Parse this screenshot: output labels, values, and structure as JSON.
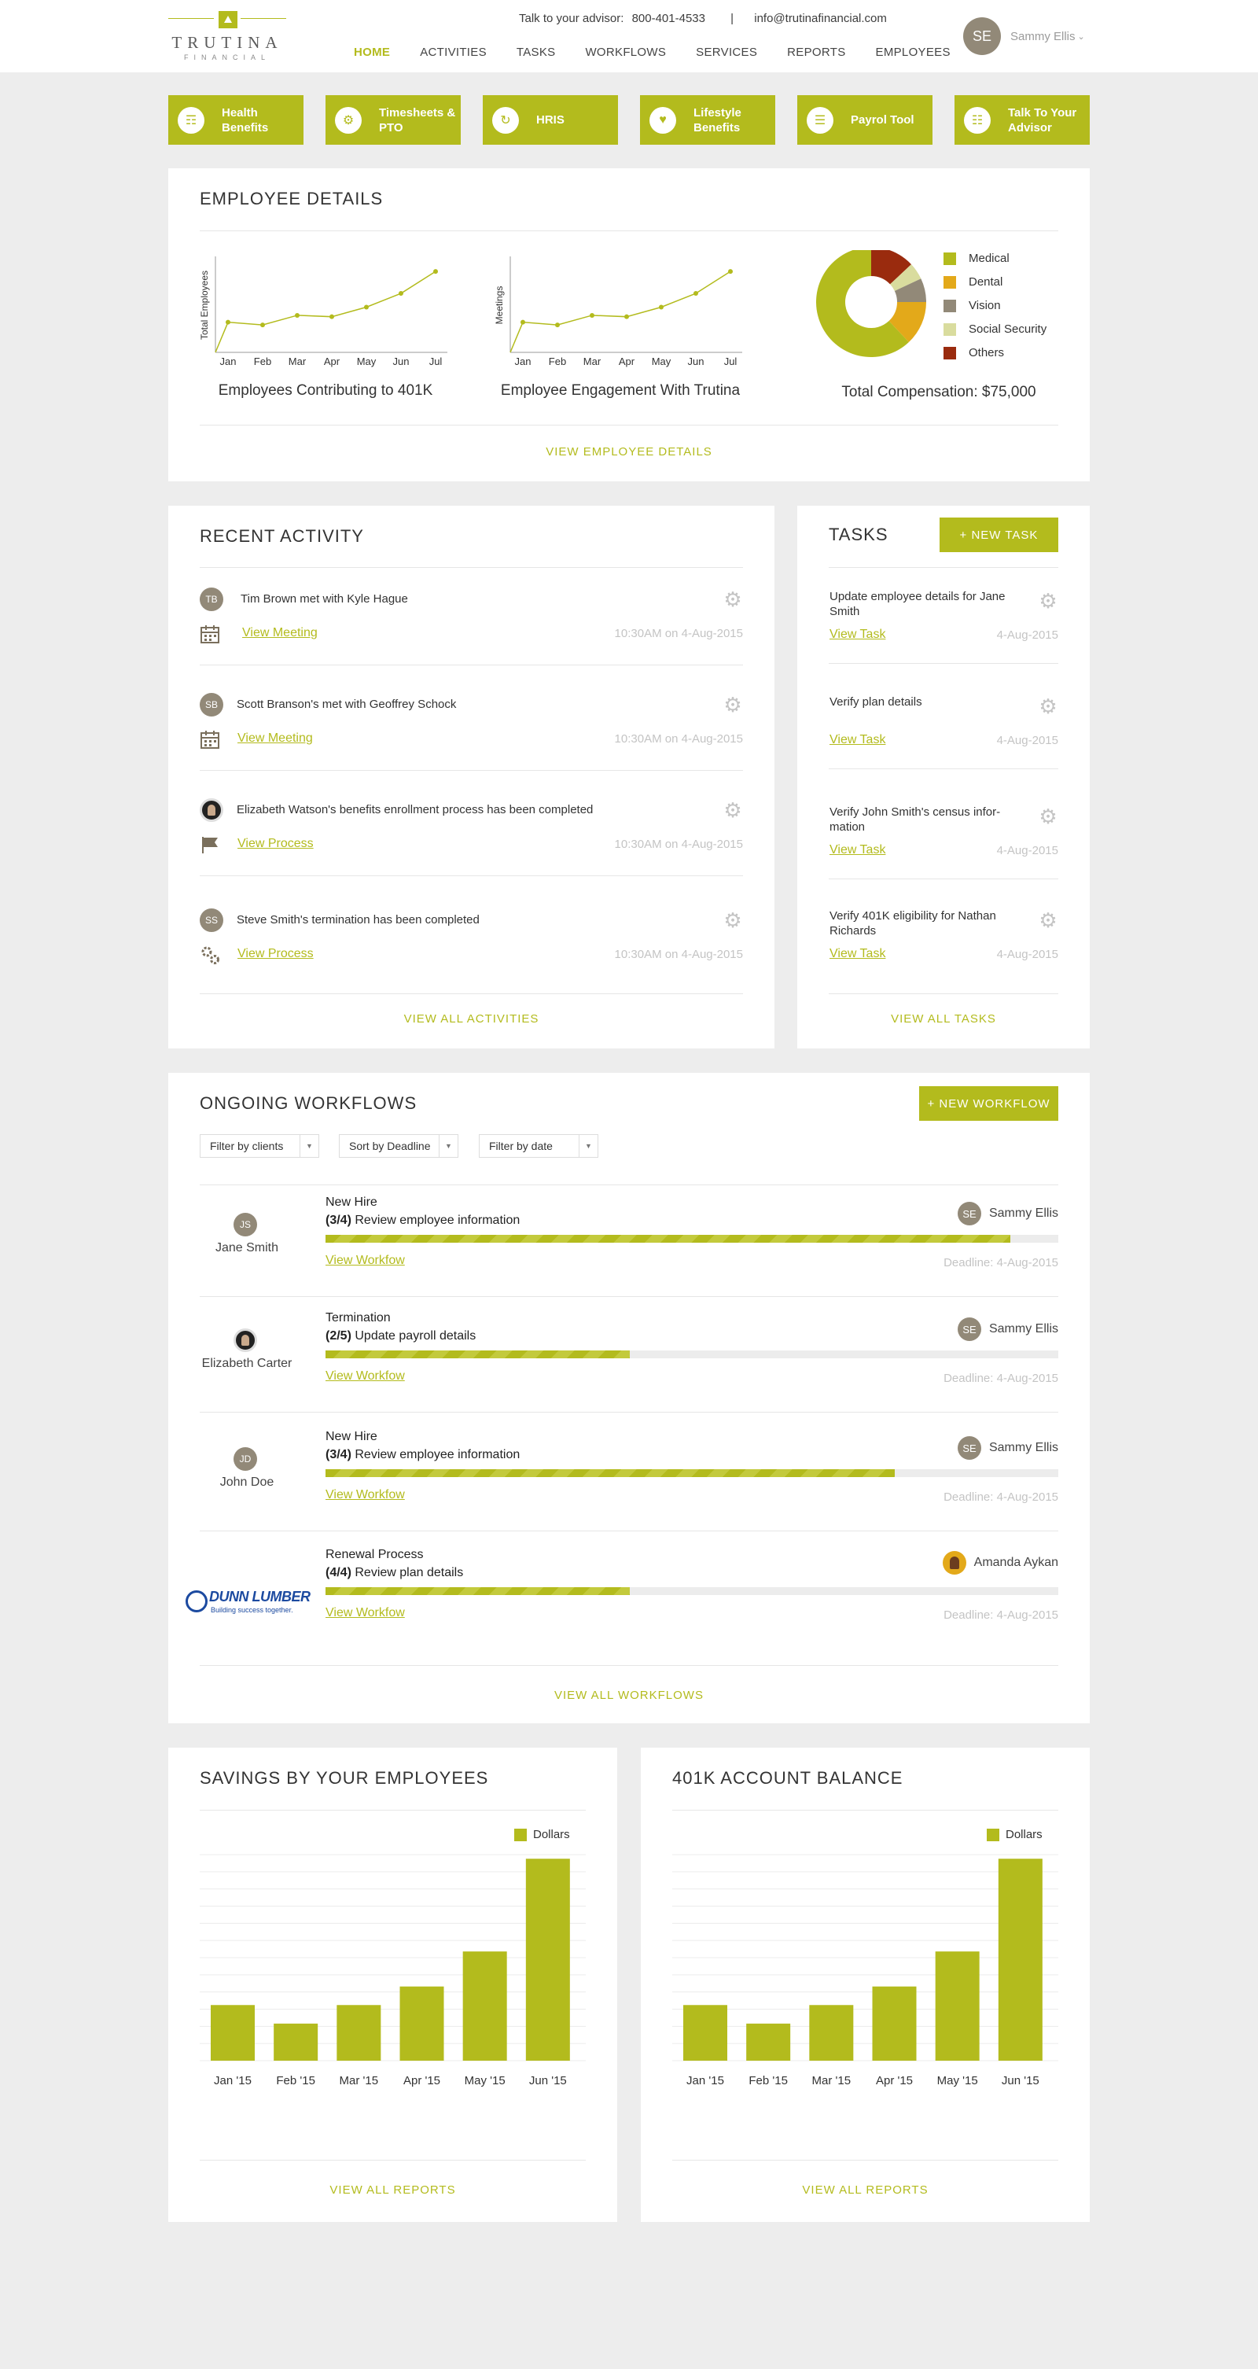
{
  "brand": {
    "name": "TRUTINA",
    "sub": "FINANCIAL",
    "accent": "#b3bb1d"
  },
  "contact": {
    "advisor_label": "Talk to your advisor:",
    "phone": "800-401-4533",
    "sep": "|",
    "email": "info@trutinafinancial.com"
  },
  "nav": {
    "items": [
      "HOME",
      "ACTIVITIES",
      "TASKS",
      "WORKFLOWS",
      "SERVICES",
      "REPORTS",
      "EMPLOYEES"
    ],
    "active": "HOME"
  },
  "user": {
    "initials": "SE",
    "name": "Sammy Ellis"
  },
  "quick_links": [
    {
      "label": "Health Benefits",
      "icon": "handshake-icon",
      "glyph": "☶"
    },
    {
      "label": "Timesheets & PTO",
      "icon": "gear-icon",
      "glyph": "⚙"
    },
    {
      "label": "HRIS",
      "icon": "refresh-icon",
      "glyph": "↻"
    },
    {
      "label": "Lifestyle Benefits",
      "icon": "heart-icon",
      "glyph": "♥"
    },
    {
      "label": "Payrol Tool",
      "icon": "list-icon",
      "glyph": "☰"
    },
    {
      "label": "Talk To Your Advisor",
      "icon": "document-icon",
      "glyph": "☷"
    }
  ],
  "employee_details": {
    "title": "EMPLOYEE DETAILS",
    "link": "VIEW EMPLOYEE DETAILS",
    "total_comp": "Total Compensation: $75,000"
  },
  "recent_activity": {
    "title": "RECENT ACTIVITY",
    "link": "VIEW ALL ACTIVITIES",
    "items": [
      {
        "initials": "TB",
        "text": "Tim Brown met with Kyle Hague",
        "link": "View Meeting",
        "time": "10:30AM on 4-Aug-2015",
        "icon": "calendar-icon"
      },
      {
        "initials": "SB",
        "text": "Scott Branson's met with Geoffrey Schock",
        "link": "View Meeting",
        "time": "10:30AM on 4-Aug-2015",
        "icon": "calendar-icon"
      },
      {
        "initials": "",
        "text": "Elizabeth Watson's benefits enrollment process has been completed",
        "link": "View Process",
        "time": "10:30AM on 4-Aug-2015",
        "icon": "flag-icon"
      },
      {
        "initials": "SS",
        "text": "Steve Smith's termination has been completed",
        "link": "View Process",
        "time": "10:30AM on 4-Aug-2015",
        "icon": "gears-icon"
      }
    ]
  },
  "tasks": {
    "title": "TASKS",
    "new_label": "+ NEW TASK",
    "link": "VIEW ALL TASKS",
    "items": [
      {
        "text": "Update employee details for Jane Smith",
        "link": "View Task",
        "date": "4-Aug-2015"
      },
      {
        "text": "Verify plan details",
        "link": "View Task",
        "date": "4-Aug-2015"
      },
      {
        "text": "Verify John Smith's census infor- mation",
        "link": "View Task",
        "date": "4-Aug-2015"
      },
      {
        "text": "Verify 401K eligibility for Nathan Richards",
        "link": "View Task",
        "date": "4-Aug-2015"
      }
    ]
  },
  "workflows": {
    "title": "ONGOING WORKFLOWS",
    "new_label": "+ NEW WORKFLOW",
    "link": "VIEW ALL WORKFLOWS",
    "filters": [
      "Filter by clients",
      "Sort by Deadline",
      "Filter by date"
    ],
    "items": [
      {
        "person": "Jane Smith",
        "initials": "JS",
        "title": "New Hire",
        "step_num": "(3/4)",
        "step": "Review employee information",
        "progress": 0.935,
        "assignee": "Sammy Ellis",
        "assignee_initials": "SE",
        "link": "View Workfow",
        "deadline": "Deadline: 4-Aug-2015"
      },
      {
        "person": "Elizabeth Carter",
        "initials": "",
        "title": "Termination",
        "step_num": "(2/5)",
        "step": "Update payroll details",
        "progress": 0.415,
        "assignee": "Sammy Ellis",
        "assignee_initials": "SE",
        "link": "View Workfow",
        "deadline": "Deadline: 4-Aug-2015"
      },
      {
        "person": "John Doe",
        "initials": "JD",
        "title": "New Hire",
        "step_num": "(3/4)",
        "step": "Review employee information",
        "progress": 0.777,
        "assignee": "Sammy Ellis",
        "assignee_initials": "SE",
        "link": "View Workfow",
        "deadline": "Deadline: 4-Aug-2015"
      },
      {
        "person": "",
        "logo": "DUNN LUMBER",
        "logo_sub": "Building success together.",
        "title": "Renewal Process",
        "step_num": "(4/4)",
        "step": "Review plan details",
        "progress": 0.415,
        "assignee": "Amanda Aykan",
        "assignee_initials": "",
        "link": "View Workfow",
        "deadline": "Deadline: 4-Aug-2015"
      }
    ]
  },
  "savings": {
    "title": "SAVINGS BY YOUR EMPLOYEES",
    "link": "VIEW ALL REPORTS"
  },
  "account_balance": {
    "title": "401K ACCOUNT BALANCE",
    "link": "VIEW ALL REPORTS"
  },
  "chart_data": [
    {
      "type": "line",
      "ylabel": "Total Employees",
      "categories": [
        "Jan",
        "Feb",
        "Mar",
        "Apr",
        "May",
        "Jun",
        "Jul"
      ],
      "values": [
        22,
        20,
        27,
        26,
        33,
        43,
        59
      ],
      "ylim": [
        0,
        70
      ],
      "caption": "Employees Contributing to 401K"
    },
    {
      "type": "line",
      "ylabel": "Meetings",
      "categories": [
        "Jan",
        "Feb",
        "Mar",
        "Apr",
        "May",
        "Jun",
        "Jul"
      ],
      "values": [
        22,
        20,
        27,
        26,
        33,
        43,
        59
      ],
      "ylim": [
        0,
        70
      ],
      "caption": "Employee Engagement  With Trutina"
    },
    {
      "type": "pie",
      "donut": true,
      "categories": [
        "Medical",
        "Dental",
        "Vision",
        "Social Security",
        "Others"
      ],
      "values": [
        62,
        13,
        7,
        5,
        13
      ],
      "colors": [
        "#b3bb1d",
        "#e3a91a",
        "#928978",
        "#d9dc9e",
        "#9a2b0e"
      ]
    },
    {
      "type": "bar",
      "legend": "Dollars",
      "categories": [
        "Jan '15",
        "Feb '15",
        "Mar '15",
        "Apr '15",
        "May '15",
        "Jun '15"
      ],
      "values": [
        27,
        18,
        27,
        36,
        53,
        98
      ],
      "ylim": [
        0,
        100
      ],
      "color": "#b3bb1d"
    },
    {
      "type": "bar",
      "legend": "Dollars",
      "categories": [
        "Jan '15",
        "Feb '15",
        "Mar '15",
        "Apr '15",
        "May '15",
        "Jun '15"
      ],
      "values": [
        27,
        18,
        27,
        36,
        53,
        98
      ],
      "ylim": [
        0,
        100
      ],
      "color": "#b3bb1d"
    }
  ]
}
